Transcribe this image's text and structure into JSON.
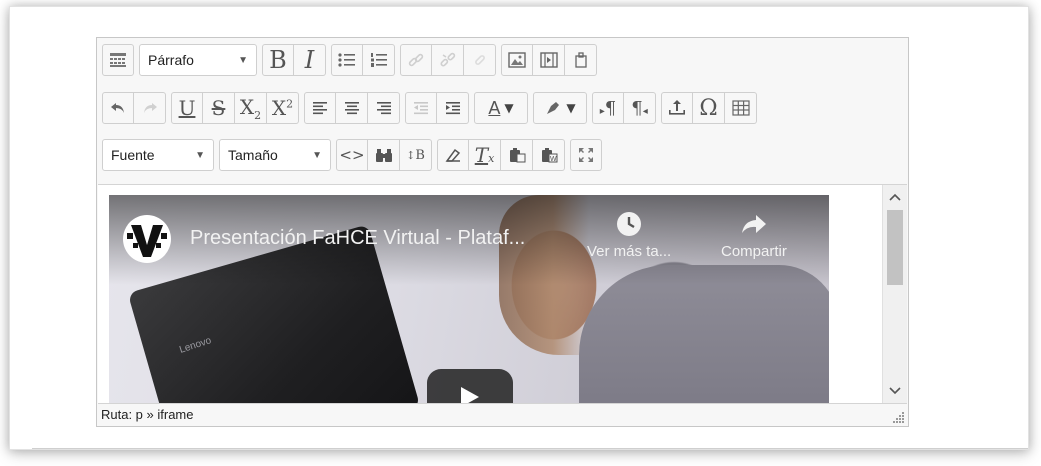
{
  "toolbar": {
    "row1": {
      "paragraph_select": "Párrafo",
      "bold": "B",
      "italic": "I"
    },
    "row2": {
      "underline": "U",
      "strikethrough": "S",
      "subscript_base": "X",
      "subscript_mark": "2",
      "superscript_base": "X",
      "superscript_mark": "2",
      "font_color_label": "A",
      "omega": "Ω",
      "paragraph_ltr": "¶",
      "paragraph_rtl": "¶"
    },
    "row3": {
      "font_select": "Fuente",
      "size_select": "Tamaño",
      "html_source": "<>",
      "replace_label": "B",
      "clear_format": "T"
    }
  },
  "video": {
    "title": "Presentación FaHCE Virtual - Plataf...",
    "watch_later": "Ver más ta...",
    "share": "Compartir",
    "laptop_brand": "Lenovo"
  },
  "statusbar": {
    "path": "Ruta: p » iframe"
  }
}
